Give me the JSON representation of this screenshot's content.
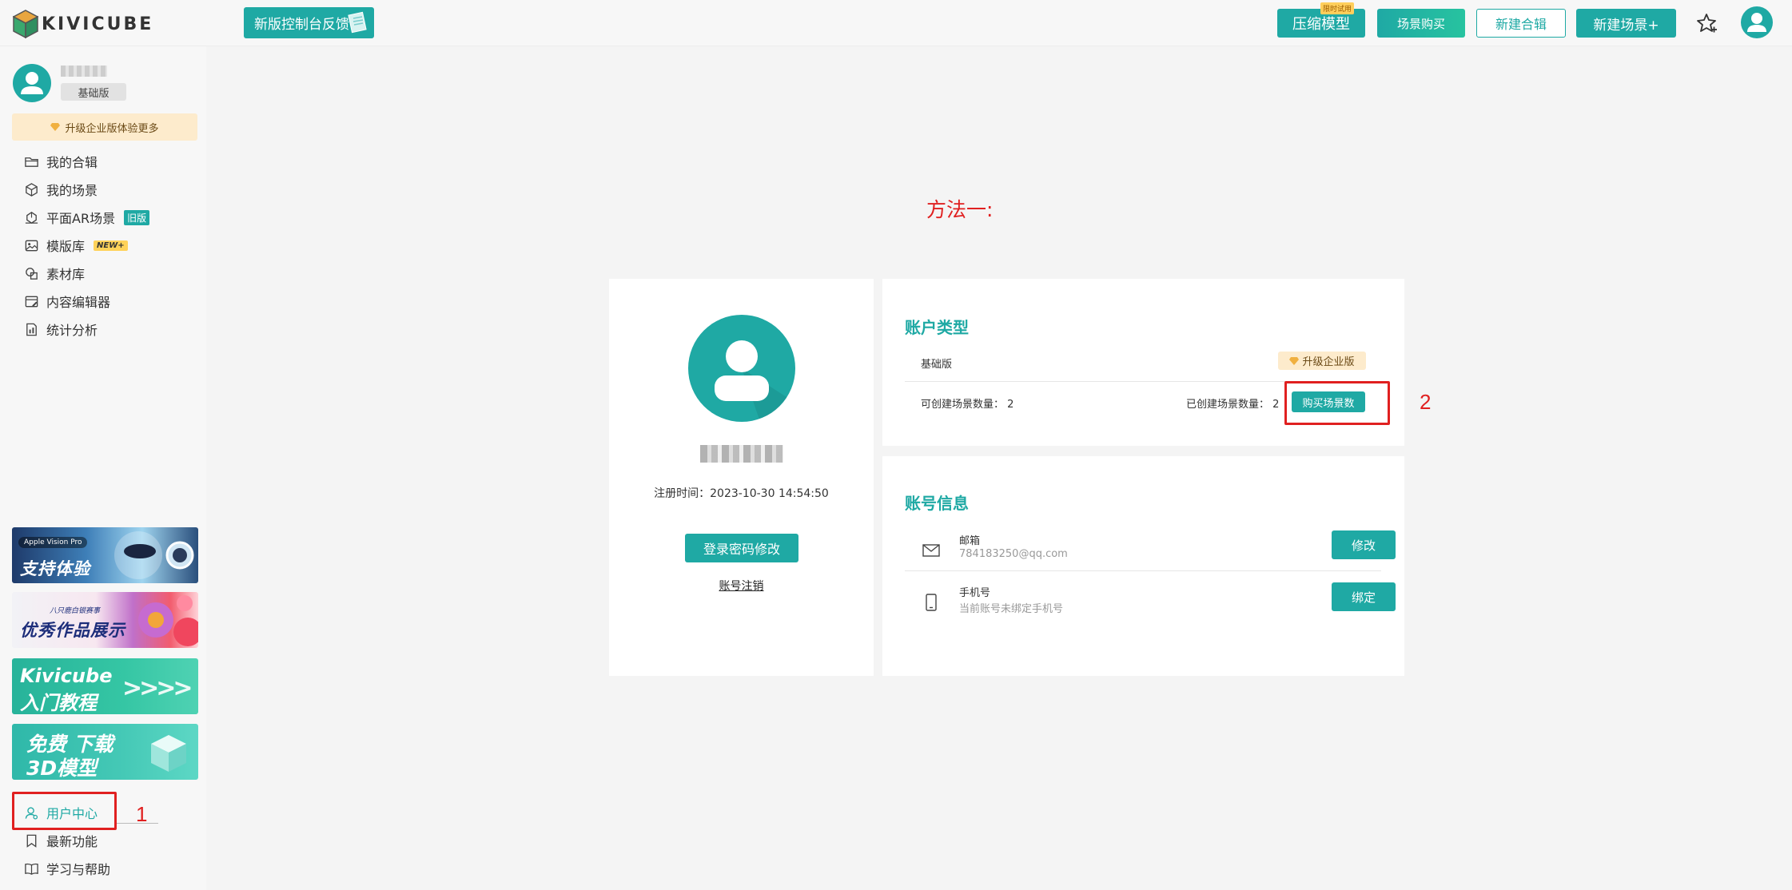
{
  "brand": {
    "name": "KIVICUBE"
  },
  "header": {
    "feedback_label": "新版控制台反馈",
    "compress_label": "压缩模型",
    "compress_tag": "限时试用",
    "buy_scene_label": "场景购买",
    "new_collection_label": "新建合辑",
    "new_scene_label": "新建场景+"
  },
  "sidebar": {
    "tier": "基础版",
    "upgrade": "升级企业版体验更多",
    "items": [
      {
        "label": "我的合辑"
      },
      {
        "label": "我的场景"
      },
      {
        "label": "平面AR场景",
        "badge": "旧版"
      },
      {
        "label": "模版库",
        "badge": "NEW+"
      },
      {
        "label": "素材库"
      },
      {
        "label": "内容编辑器"
      },
      {
        "label": "统计分析"
      }
    ],
    "banners": [
      {
        "small": "Apple Vision Pro",
        "big": "支持体验"
      },
      {
        "small": "八只鹿白银赛事",
        "big": "优秀作品展示"
      },
      {
        "big1": "Kivicube",
        "big2": "入门教程",
        "arrows": ">>>>"
      },
      {
        "big1": "免费 下载",
        "big2": "3D模型"
      }
    ],
    "bottom_items": [
      {
        "label": "用户中心"
      },
      {
        "label": "最新功能"
      },
      {
        "label": "学习与帮助"
      }
    ]
  },
  "annotations": {
    "method": "方法一:",
    "step1": "1",
    "step2": "2"
  },
  "profile": {
    "reg_time": "注册时间：2023-10-30 14:54:50",
    "change_pwd_label": "登录密码修改",
    "cancel_account_label": "账号注销"
  },
  "account_type": {
    "title": "账户类型",
    "tier": "基础版",
    "upgrade_label": "升级企业版",
    "can_create": "可创建场景数量：  2",
    "created": "已创建场景数量：  2",
    "buy_label": "购买场景数"
  },
  "account_info": {
    "title": "账号信息",
    "email_label": "邮箱",
    "email_value": "784183250@qq.com",
    "email_btn": "修改",
    "phone_label": "手机号",
    "phone_value": "当前账号未绑定手机号",
    "phone_btn": "绑定"
  },
  "colors": {
    "accent": "#1fa9a4",
    "annotation": "#e02020",
    "upgrade_bg": "#fdebcc"
  }
}
